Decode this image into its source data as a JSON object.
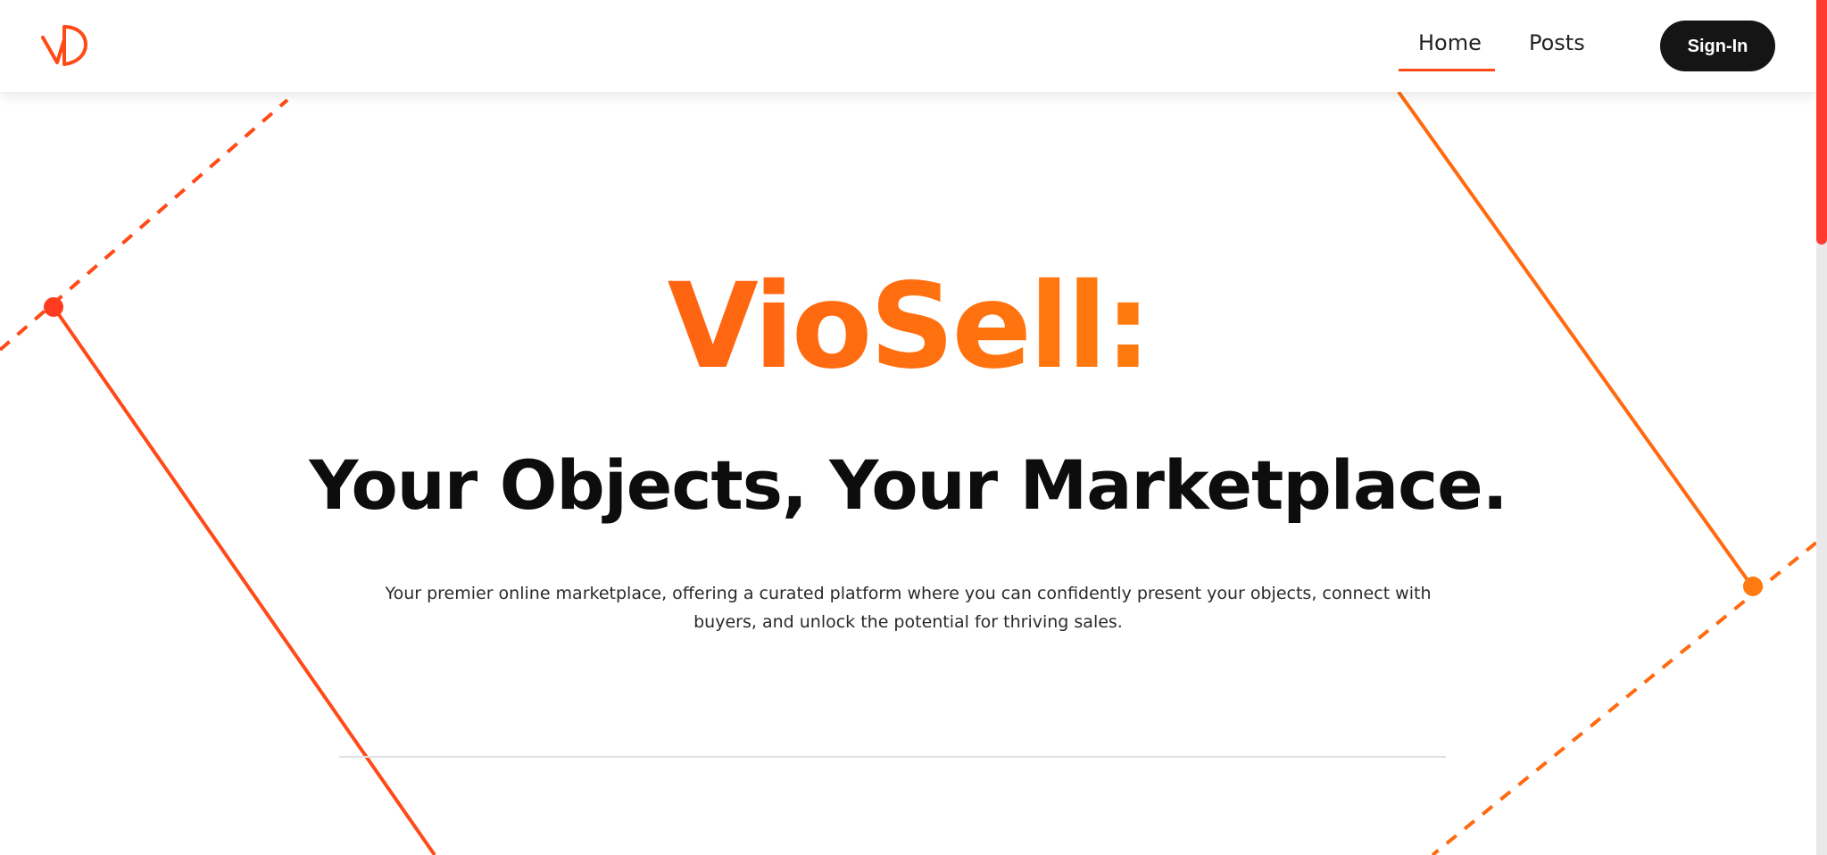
{
  "nav": {
    "logo_icon": "vd-monogram-logo-icon",
    "links": [
      {
        "label": "Home",
        "active": true
      },
      {
        "label": "Posts",
        "active": false
      }
    ],
    "signin_label": "Sign-In"
  },
  "hero": {
    "brand": "VioSell:",
    "tagline": "Your Objects, Your Marketplace.",
    "description": "Your premier online marketplace, offering a curated platform where you can confidently present your objects, connect with buyers, and unlock the potential for thriving sales."
  },
  "colors": {
    "accent": "#ff4a17",
    "accent_light": "#ff8a0a",
    "button_bg": "#151515",
    "text": "#0d0d0d"
  }
}
